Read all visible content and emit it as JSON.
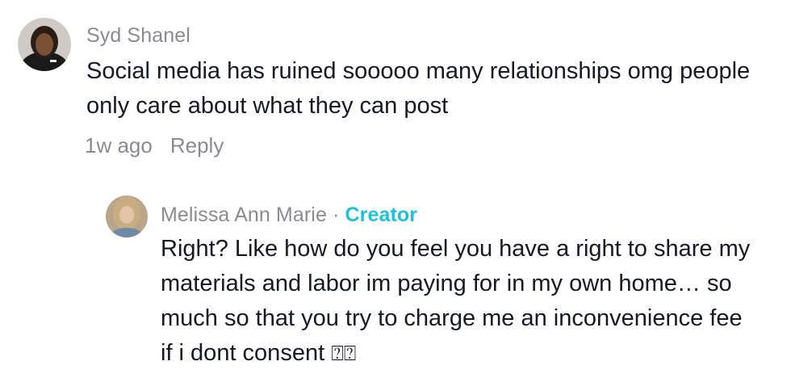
{
  "comments": [
    {
      "author": "Syd Shanel",
      "text": "Social media has ruined sooooo many relationships omg people only care about what they can post",
      "time": "1w ago",
      "reply_label": "Reply"
    }
  ],
  "replies": [
    {
      "author": "Melissa Ann Marie",
      "separator": "·",
      "badge": "Creator",
      "text": "Right? Like how do you feel you have a right to share my materials and labor im paying for in my own home… so much so that you try to charge me an inconvenience fee if i dont consent",
      "emoji_placeholder": "⍰⍰"
    }
  ],
  "colors": {
    "text": "#161823",
    "secondary": "#8a8b91",
    "creator_badge": "#20c0d8"
  },
  "icons": {
    "unsupported_glyph": "missing-glyph-box-icon"
  }
}
